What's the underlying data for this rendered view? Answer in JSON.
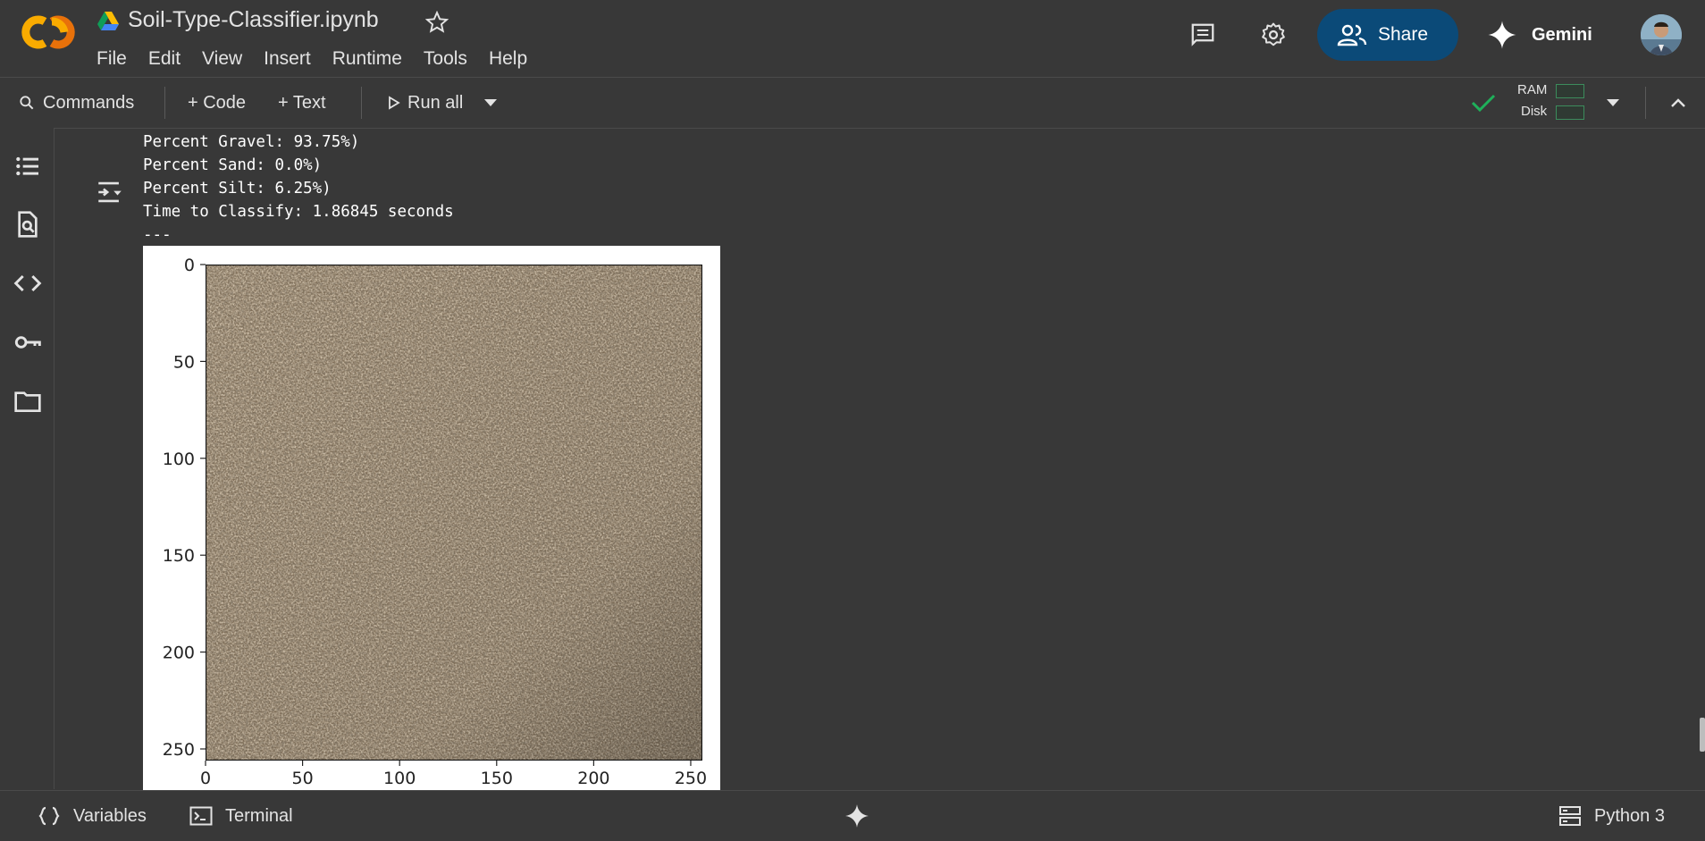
{
  "app": {
    "notebook_title": "Soil-Type-Classifier.ipynb",
    "menu": [
      "File",
      "Edit",
      "View",
      "Insert",
      "Runtime",
      "Tools",
      "Help"
    ],
    "share_label": "Share",
    "gemini_label": "Gemini"
  },
  "toolbar": {
    "commands_label": "Commands",
    "add_code_label": "+ Code",
    "add_text_label": "+ Text",
    "run_all_label": "Run all",
    "ram_label": "RAM",
    "disk_label": "Disk",
    "status_color": "#1fb05a"
  },
  "sidebar_icons": [
    "table-of-contents-icon",
    "find-replace-icon",
    "code-snippets-icon",
    "secrets-key-icon",
    "files-folder-icon"
  ],
  "output": {
    "lines": [
      "Percent Gravel: 93.75%)",
      "Percent Sand: 0.0%)",
      "Percent Silt: 6.25%)",
      "Time to Classify: 1.86845 seconds",
      "---"
    ]
  },
  "chart_data": {
    "type": "image",
    "xlim": [
      0,
      256
    ],
    "ylim": [
      256,
      0
    ],
    "x_ticks": [
      "0",
      "50",
      "100",
      "150",
      "200",
      "250"
    ],
    "y_ticks": [
      "0",
      "50",
      "100",
      "150",
      "200",
      "250"
    ],
    "x_tick_values": [
      0,
      50,
      100,
      150,
      200,
      250
    ],
    "y_tick_values": [
      0,
      50,
      100,
      150,
      200,
      250
    ]
  },
  "bottom": {
    "variables_label": "Variables",
    "terminal_label": "Terminal",
    "runtime_label": "Python 3"
  }
}
